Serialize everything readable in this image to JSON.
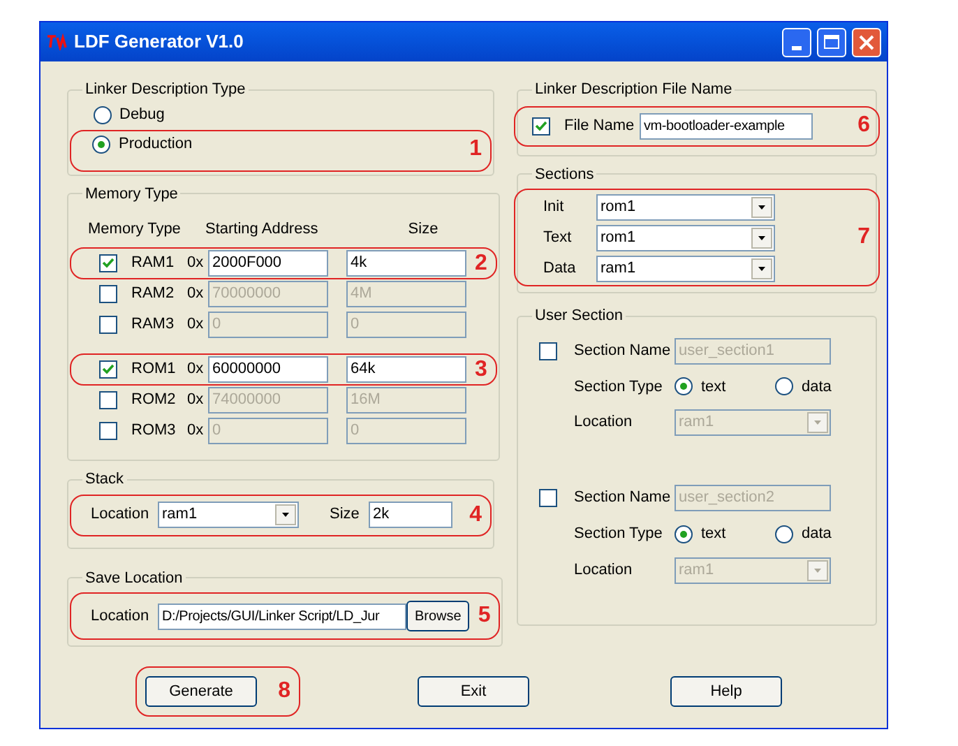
{
  "window": {
    "title": "LDF Generator V1.0"
  },
  "linker_type": {
    "label": "Linker Description Type",
    "callout": "1",
    "options": [
      {
        "label": "Debug",
        "selected": false
      },
      {
        "label": "Production",
        "selected": true
      }
    ]
  },
  "file_name": {
    "label": "Linker Description File Name",
    "field_label": "File Name",
    "checked": true,
    "value": "vm-bootloader-example",
    "callout": "6"
  },
  "memory": {
    "label": "Memory Type",
    "columns": [
      "Memory Type",
      "Starting Address",
      "Size"
    ],
    "groups": [
      {
        "rows": [
          {
            "name": "RAM1",
            "checked": true,
            "prefix": "0x",
            "address": "2000F000",
            "size": "4k",
            "callout": "2"
          },
          {
            "name": "RAM2",
            "checked": false,
            "prefix": "0x",
            "address": "70000000",
            "size": "4M"
          },
          {
            "name": "RAM3",
            "checked": false,
            "prefix": "0x",
            "address": "0",
            "size": "0"
          }
        ]
      },
      {
        "rows": [
          {
            "name": "ROM1",
            "checked": true,
            "prefix": "0x",
            "address": "60000000",
            "size": "64k",
            "callout": "3"
          },
          {
            "name": "ROM2",
            "checked": false,
            "prefix": "0x",
            "address": "74000000",
            "size": "16M"
          },
          {
            "name": "ROM3",
            "checked": false,
            "prefix": "0x",
            "address": "0",
            "size": "0"
          }
        ]
      }
    ]
  },
  "stack": {
    "label": "Stack",
    "location_label": "Location",
    "location": "ram1",
    "size_label": "Size",
    "size": "2k",
    "callout": "4"
  },
  "save_location": {
    "label": "Save Location",
    "location_label": "Location",
    "path": "D:/Projects/GUI/Linker Script/LD_Jur",
    "browse": "Browse",
    "callout": "5"
  },
  "sections": {
    "label": "Sections",
    "callout": "7",
    "rows": [
      {
        "label": "Init",
        "value": "rom1"
      },
      {
        "label": "Text",
        "value": "rom1"
      },
      {
        "label": "Data",
        "value": "ram1"
      }
    ]
  },
  "user_section": {
    "label": "User Section",
    "items": [
      {
        "checked": false,
        "name_label": "Section Name",
        "name": "user_section1",
        "type_label": "Section Type",
        "types": [
          {
            "label": "text",
            "selected": true
          },
          {
            "label": "data",
            "selected": false
          }
        ],
        "location_label": "Location",
        "location": "ram1"
      },
      {
        "checked": false,
        "name_label": "Section Name",
        "name": "user_section2",
        "type_label": "Section Type",
        "types": [
          {
            "label": "text",
            "selected": true
          },
          {
            "label": "data",
            "selected": false
          }
        ],
        "location_label": "Location",
        "location": "ram1"
      }
    ]
  },
  "buttons": [
    {
      "label": "Generate",
      "callout": "8"
    },
    {
      "label": "Exit"
    },
    {
      "label": "Help"
    }
  ]
}
